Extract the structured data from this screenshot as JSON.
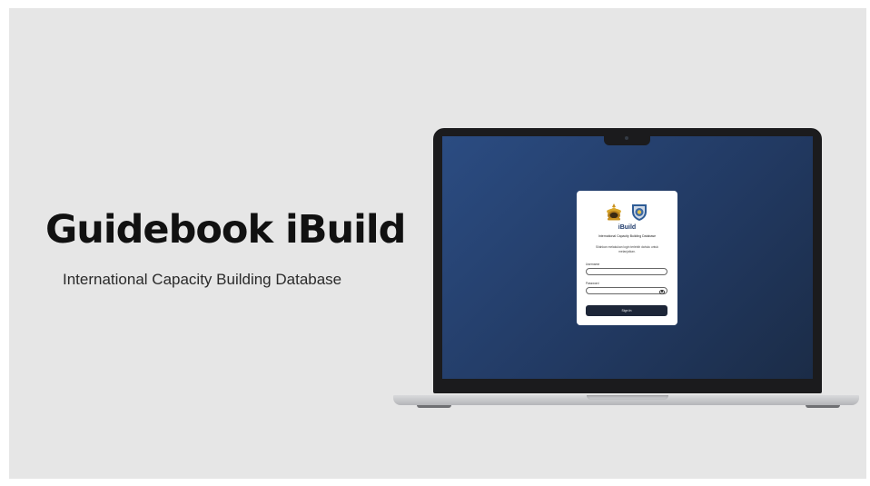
{
  "slide": {
    "title": "Guidebook iBuild",
    "subtitle": "International Capacity Building Database"
  },
  "login_card": {
    "app_name": "iBuild",
    "app_fullname": "International Capacity Building Database",
    "description": "Silahkan melakukan login terlebih dahulu untuk melanjutkan.",
    "username_label": "Username",
    "username_value": "",
    "password_label": "Password",
    "password_value": "",
    "signin_label": "Sign In",
    "logos": [
      "police-emblem-icon",
      "shield-emblem-icon"
    ]
  },
  "colors": {
    "background": "#e6e6e6",
    "screen_gradient_start": "#2b4c82",
    "screen_gradient_end": "#1b2c47",
    "brand_blue": "#1e3a6b",
    "button_dark": "#1d2638"
  }
}
